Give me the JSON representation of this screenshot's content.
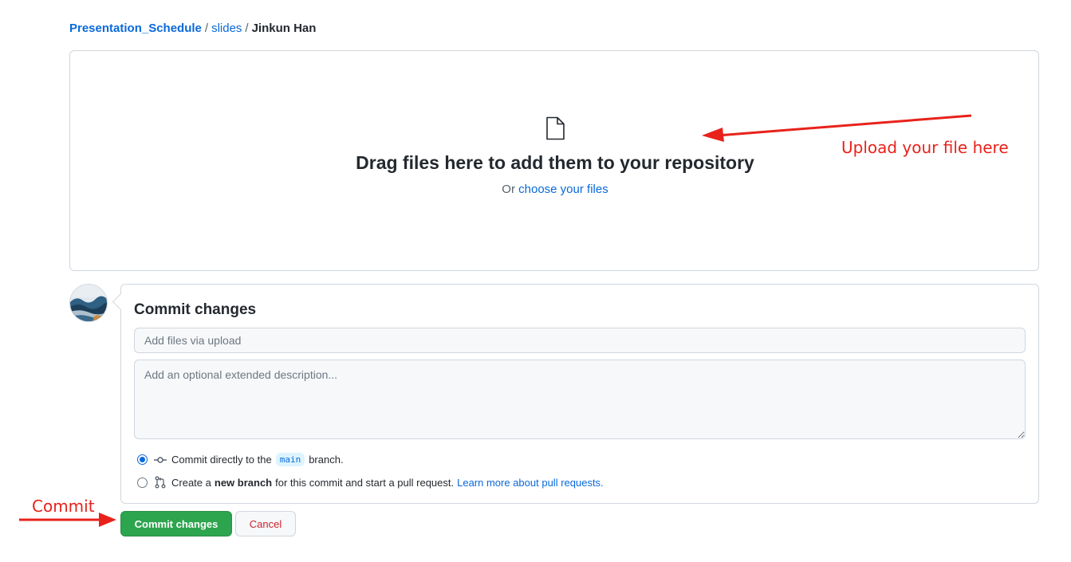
{
  "breadcrumb": {
    "repo": "Presentation_Schedule",
    "separator": "/",
    "folder": "slides",
    "current": "Jinkun Han"
  },
  "dropzone": {
    "icon": "file-icon",
    "title": "Drag files here to add them to your repository",
    "or_text": "Or",
    "choose_link": "choose your files"
  },
  "commit": {
    "title": "Commit changes",
    "summary_placeholder": "Add files via upload",
    "description_placeholder": "Add an optional extended description...",
    "option_direct": {
      "prefix": "Commit directly to the",
      "branch": "main",
      "suffix": "branch.",
      "selected": true
    },
    "option_new_branch": {
      "prefix": "Create a",
      "bold": "new branch",
      "suffix": "for this commit and start a pull request.",
      "link": "Learn more about pull requests.",
      "selected": false
    },
    "commit_button": "Commit changes",
    "cancel_button": "Cancel"
  },
  "annotations": {
    "upload_hint": "Upload your file here",
    "commit_hint": "Commit",
    "color": "#e8221b"
  },
  "colors": {
    "link": "#0969da",
    "primary": "#2da44e",
    "danger": "#cf222e",
    "border": "#d0d7de"
  }
}
